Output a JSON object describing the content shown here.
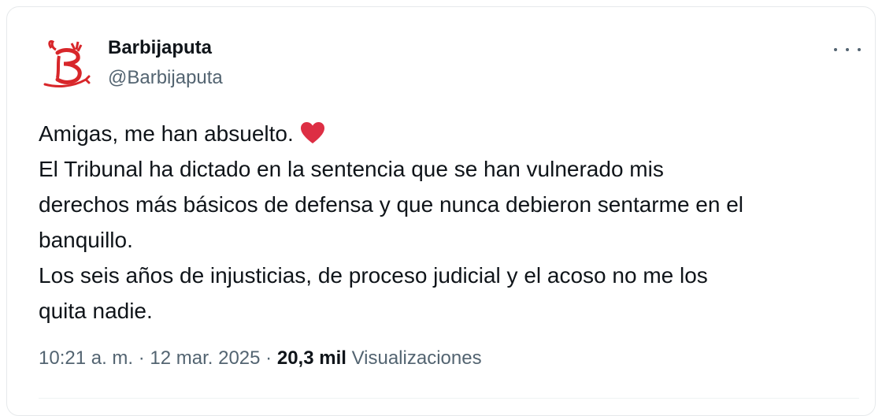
{
  "author": {
    "name": "Barbijaputa",
    "handle": "@Barbijaputa",
    "avatar_icon": "red-devil-logo-icon"
  },
  "more_icon": "more-options-icon",
  "tweet": {
    "line_1": "Amigas, me han absuelto.",
    "emoji": "red-heart",
    "line_2": "El Tribunal ha dictado en la sentencia que se han vulnerado mis",
    "line_3": "derechos más básicos de defensa y que nunca debieron sentarme en el",
    "line_4": "banquillo.",
    "line_5": "Los seis años de injusticias, de proceso judicial y el acoso no me los",
    "line_6": "quita nadie."
  },
  "meta": {
    "time": "10:21 a. m.",
    "separator": " · ",
    "date": "12 mar. 2025",
    "views_count": "20,3 mil",
    "views_label": "Visualizaciones"
  },
  "colors": {
    "text": "#0f1419",
    "secondary": "#536471",
    "accent_red": "#e0245e"
  }
}
